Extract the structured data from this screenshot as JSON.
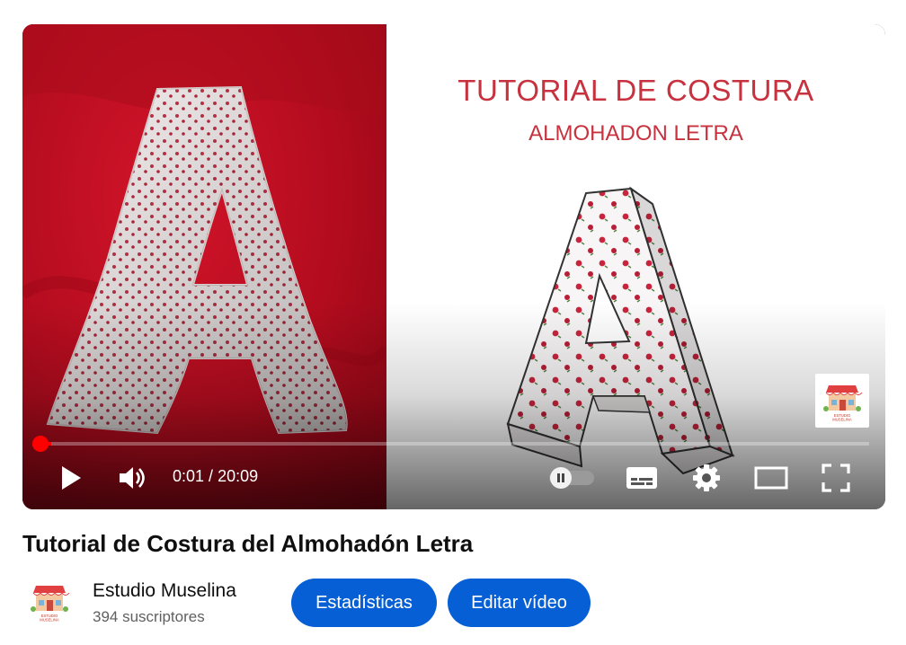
{
  "video": {
    "overlay_title": "TUTORIAL DE COSTURA",
    "overlay_subtitle": "ALMOHADON LETRA",
    "watermark_text": "ESTUDIO MUSELINA",
    "progress_fraction": 0.0008,
    "time_current": "0:01",
    "time_separator": " / ",
    "time_total": "20:09",
    "accent_color": "#ff0000"
  },
  "controls": {
    "play_icon": "play-icon",
    "volume_icon": "volume-icon",
    "autoplay_icon": "autoplay-toggle-icon",
    "subtitles_icon": "subtitles-icon",
    "settings_icon": "gear-icon",
    "theater_icon": "theater-mode-icon",
    "fullscreen_icon": "fullscreen-icon"
  },
  "details": {
    "title": "Tutorial de Costura del Almohadón Letra",
    "channel_name": "Estudio Muselina",
    "subscribers": "394 suscriptores",
    "stats_button": "Estadísticas",
    "edit_button": "Editar vídeo",
    "button_color": "#065fd4"
  }
}
